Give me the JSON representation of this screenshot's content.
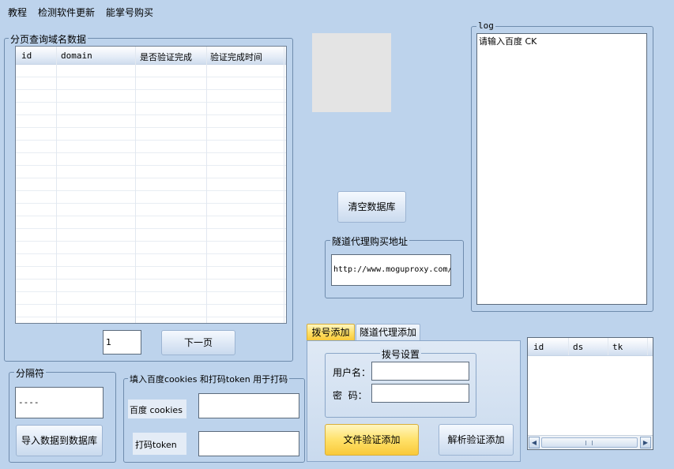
{
  "menu": {
    "items": [
      "教程",
      "检测软件更新",
      "能掌号购买"
    ]
  },
  "domain_panel": {
    "title": "分页查询域名数据",
    "columns": [
      "id",
      "domain",
      "是否验证完成",
      "验证完成时间"
    ],
    "page_value": "1",
    "next_label": "下一页"
  },
  "clear_db_label": "清空数据库",
  "proxy": {
    "title": "隧道代理购买地址",
    "url": "http://www.moguproxy.com/"
  },
  "log": {
    "title": "log",
    "text": "请输入百度 CK"
  },
  "separator": {
    "title": "分隔符",
    "value": "----",
    "import_label": "导入数据到数据库"
  },
  "cookies": {
    "title": "填入百度cookies 和打码token 用于打码",
    "cookies_label": "百度 cookies",
    "token_label": "打码token"
  },
  "tabs": {
    "items": [
      "拨号添加",
      "隧道代理添加"
    ],
    "active": 0,
    "dial_settings_title": "拨号设置",
    "username_label": "用户名：",
    "password_label": "密  码：",
    "file_verify_label": "文件验证添加",
    "parse_verify_label": "解析验证添加"
  },
  "small_grid": {
    "columns": [
      "id",
      "ds",
      "tk"
    ]
  },
  "colors": {
    "background": "#bdd3ec",
    "accent_yellow": "#ffe169",
    "border": "#6f8cad"
  }
}
